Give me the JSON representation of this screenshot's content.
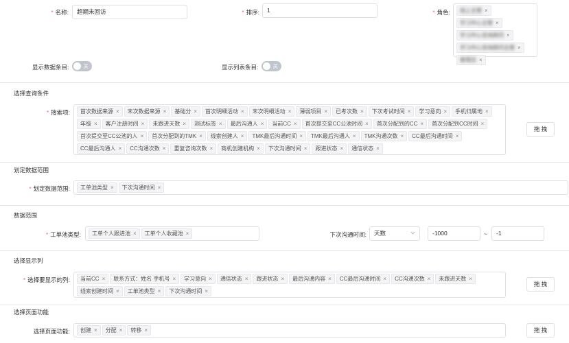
{
  "top": {
    "name_label": "名称:",
    "name_value": "超期未回访",
    "sort_label": "排序:",
    "sort_value": "1",
    "role_label": "角色:",
    "roles": [
      "线上主管",
      "学习中心主管",
      "学习中心咨询顾问",
      "学习中心咨询顾问主管",
      "管理员"
    ]
  },
  "switches": {
    "show_data_label": "显示数据条目:",
    "show_data_state": "关",
    "show_list_label": "显示列表条目:",
    "show_list_state": "关"
  },
  "query": {
    "section_title": "选择查询条件",
    "search_label": "搜索项:",
    "items": [
      "首次数据来源",
      "末次数据来源",
      "基础分",
      "首次明细活动",
      "末次明细活动",
      "薄弱项目",
      "已考次数",
      "下次考试时间",
      "学习意向",
      "手机归属地",
      "年级",
      "客户注册时间",
      "未跟进天数",
      "测试标签",
      "最后沟通人",
      "当前CC",
      "首次提交至CC公池时间",
      "首次分配到的CC",
      "首次分配到CC时间",
      "首次提交至CC公池的人",
      "首次分配到的TMK",
      "线索创建人",
      "TMK最后沟通时间",
      "TMK最后沟通人",
      "TMK沟通次数",
      "CC最后沟通时间",
      "CC最后沟通人",
      "CC沟通次数",
      "重复咨询次数",
      "商机创建机构",
      "下次沟通时间",
      "跟进状态",
      "通信状态"
    ],
    "drag_button": "拖 拽"
  },
  "scope": {
    "section_title": "划定数据范围",
    "label": "划定数据范围:",
    "items": [
      "工单池类型",
      "下次沟通时间"
    ]
  },
  "range": {
    "section_title": "数据范围",
    "pool_label": "工单池类型:",
    "pool_items": [
      "工单个人跟进池",
      "工单个人收藏池"
    ],
    "next_label": "下次沟通时间:",
    "unit_value": "天数",
    "from_value": "-1000",
    "tilde": "~",
    "to_value": "-1"
  },
  "columns": {
    "section_title": "选择显示列",
    "label": "选择要显示的列:",
    "items": [
      "当前CC",
      "联系方式：姓名 手机号",
      "学习意向",
      "通信状态",
      "跟进状态",
      "最后沟通内容",
      "CC最后沟通时间",
      "CC沟通次数",
      "未跟进天数",
      "线索创建时间",
      "工单池类型",
      "下次沟通时间"
    ],
    "drag_button": "拖 拽"
  },
  "page_funcs": {
    "section_title": "选择页面功能",
    "label": "选择页面功能:",
    "items": [
      "创建",
      "分配",
      "转移"
    ],
    "drag_button": "拖 拽"
  },
  "icons": {
    "tag_close": "close-icon",
    "select_arrow": "chevron-down-icon"
  }
}
